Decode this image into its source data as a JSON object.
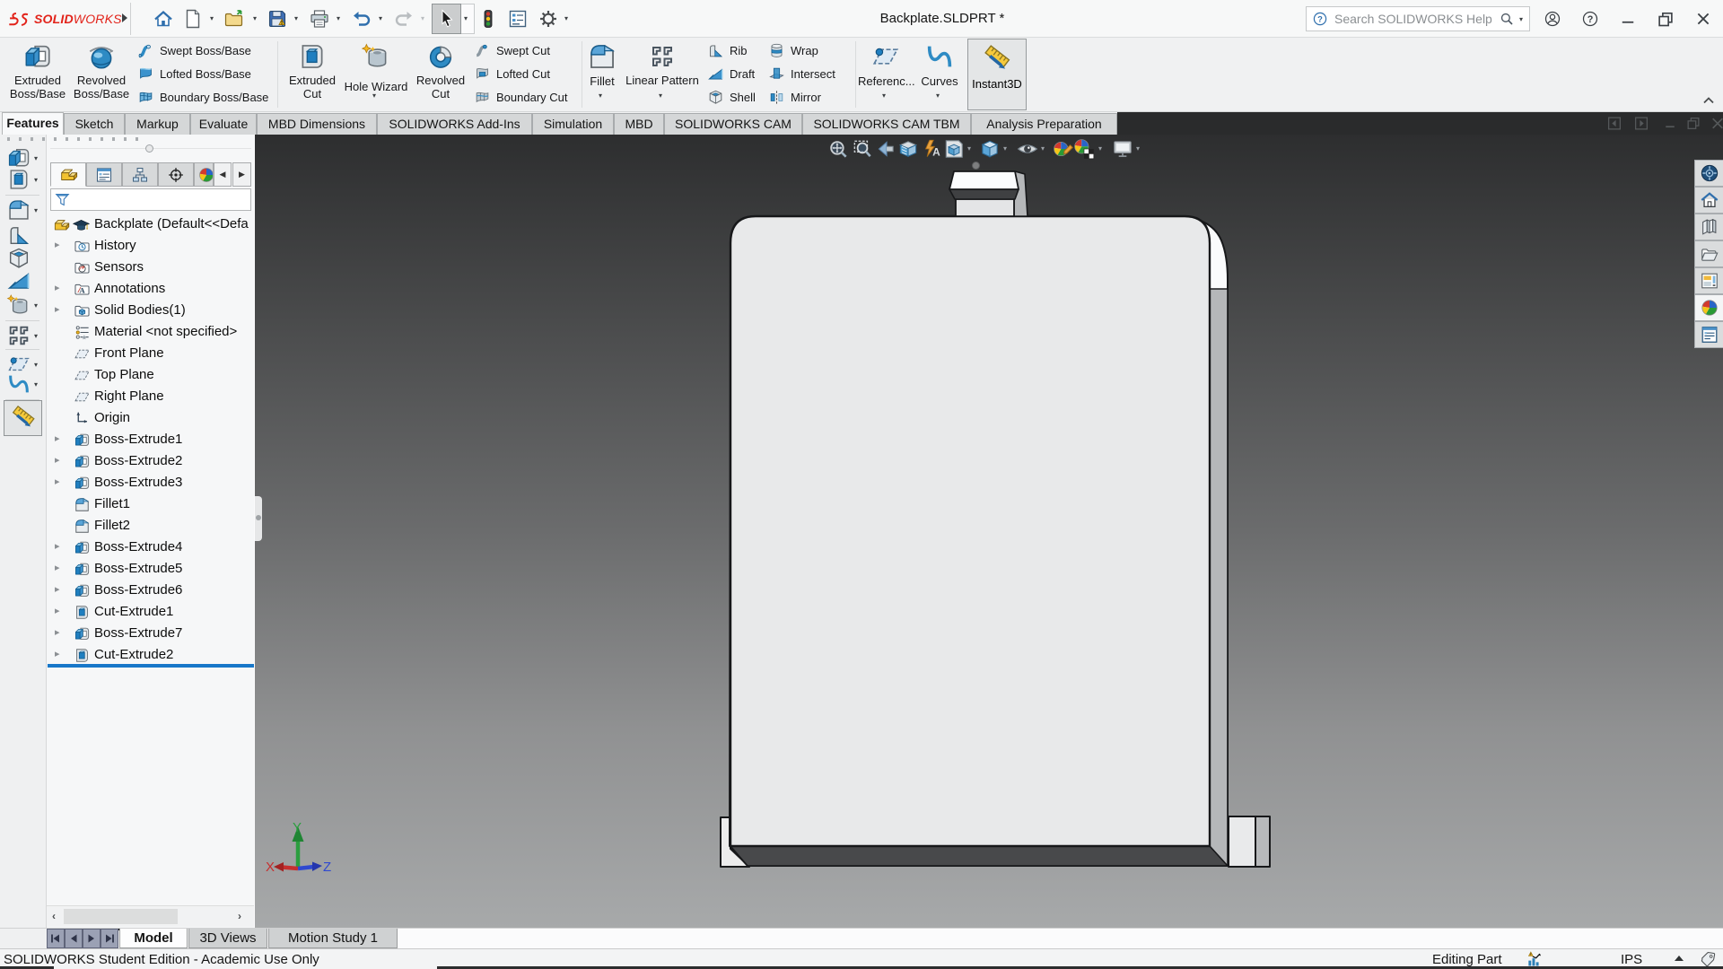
{
  "titlebar": {
    "brand_mark": "3S",
    "brand_bold": "SOLID",
    "brand_light": "WORKS",
    "document_title": "Backplate.SLDPRT *",
    "search_placeholder": "Search SOLIDWORKS Help",
    "quick_access_icons": [
      "home",
      "new-document",
      "open",
      "save",
      "print",
      "undo",
      "redo",
      "select-cursor",
      "rebuild",
      "file-properties",
      "options-gear"
    ],
    "window_icons": [
      "user-account",
      "help",
      "minimize",
      "restore",
      "close"
    ]
  },
  "ribbon": {
    "large_buttons": [
      {
        "line1": "Extruded",
        "line2": "Boss/Base",
        "icon": "extruded-boss-base"
      },
      {
        "line1": "Revolved",
        "line2": "Boss/Base",
        "icon": "revolved-boss-base"
      },
      {
        "line1": "Extruded",
        "line2": "Cut",
        "icon": "extruded-cut"
      },
      {
        "line1": "Hole Wizard",
        "line2": "",
        "icon": "hole-wizard"
      },
      {
        "line1": "Revolved",
        "line2": "Cut",
        "icon": "revolved-cut"
      },
      {
        "line1": "Fillet",
        "line2": "",
        "icon": "fillet"
      },
      {
        "line1": "Linear Pattern",
        "line2": "",
        "icon": "linear-pattern"
      },
      {
        "line1": "Referenc...",
        "line2": "",
        "icon": "reference-geometry"
      },
      {
        "line1": "Curves",
        "line2": "",
        "icon": "curves"
      },
      {
        "line1": "Instant3D",
        "line2": "",
        "icon": "instant3d",
        "active": true
      }
    ],
    "small_buttons": [
      {
        "label": "Swept Boss/Base",
        "icon": "swept-boss-base"
      },
      {
        "label": "Lofted Boss/Base",
        "icon": "lofted-boss-base"
      },
      {
        "label": "Boundary Boss/Base",
        "icon": "boundary-boss-base"
      },
      {
        "label": "Swept Cut",
        "icon": "swept-cut"
      },
      {
        "label": "Lofted Cut",
        "icon": "lofted-cut"
      },
      {
        "label": "Boundary Cut",
        "icon": "boundary-cut"
      },
      {
        "label": "Rib",
        "icon": "rib"
      },
      {
        "label": "Draft",
        "icon": "draft"
      },
      {
        "label": "Shell",
        "icon": "shell"
      },
      {
        "label": "Wrap",
        "icon": "wrap"
      },
      {
        "label": "Intersect",
        "icon": "intersect"
      },
      {
        "label": "Mirror",
        "icon": "mirror"
      }
    ],
    "collapse_icon": "chevron-up"
  },
  "command_tabs": [
    {
      "label": "Features",
      "active": true
    },
    {
      "label": "Sketch"
    },
    {
      "label": "Markup"
    },
    {
      "label": "Evaluate"
    },
    {
      "label": "MBD Dimensions"
    },
    {
      "label": "SOLIDWORKS Add-Ins"
    },
    {
      "label": "Simulation"
    },
    {
      "label": "MBD"
    },
    {
      "label": "SOLIDWORKS CAM"
    },
    {
      "label": "SOLIDWORKS CAM TBM"
    },
    {
      "label": "Analysis Preparation"
    }
  ],
  "document_window_icons": [
    "previous-window",
    "next-window",
    "minimize",
    "restore",
    "close"
  ],
  "left_toolbar_icons": [
    "extruded-boss-base",
    "extruded-cut",
    "fillet",
    "rib",
    "shell",
    "draft",
    "hole-wizard",
    "linear-pattern",
    "reference-geometry",
    "curves",
    "instant3d"
  ],
  "feature_manager": {
    "tab_icons": [
      "feature-tree",
      "property-manager",
      "configuration-manager",
      "dimxpert-manager",
      "display-manager"
    ],
    "scroll_icons": [
      "scroll-left",
      "scroll-right"
    ],
    "filter_icon": "filter-funnel",
    "tree": [
      {
        "label": "Backplate (Default<<Defa",
        "icon": "part",
        "icon2": "graduation-cap",
        "root": true
      },
      {
        "label": "History",
        "icon": "folder-history",
        "expandable": true
      },
      {
        "label": "Sensors",
        "icon": "folder-sensors"
      },
      {
        "label": "Annotations",
        "icon": "folder-annotations",
        "expandable": true
      },
      {
        "label": "Solid Bodies(1)",
        "icon": "folder-solid-bodies",
        "expandable": true
      },
      {
        "label": "Material <not specified>",
        "icon": "material"
      },
      {
        "label": "Front Plane",
        "icon": "plane"
      },
      {
        "label": "Top Plane",
        "icon": "plane"
      },
      {
        "label": "Right Plane",
        "icon": "plane"
      },
      {
        "label": "Origin",
        "icon": "origin"
      },
      {
        "label": "Boss-Extrude1",
        "icon": "boss-extrude",
        "expandable": true
      },
      {
        "label": "Boss-Extrude2",
        "icon": "boss-extrude",
        "expandable": true
      },
      {
        "label": "Boss-Extrude3",
        "icon": "boss-extrude",
        "expandable": true
      },
      {
        "label": "Fillet1",
        "icon": "fillet"
      },
      {
        "label": "Fillet2",
        "icon": "fillet"
      },
      {
        "label": "Boss-Extrude4",
        "icon": "boss-extrude",
        "expandable": true
      },
      {
        "label": "Boss-Extrude5",
        "icon": "boss-extrude",
        "expandable": true
      },
      {
        "label": "Boss-Extrude6",
        "icon": "boss-extrude",
        "expandable": true
      },
      {
        "label": "Cut-Extrude1",
        "icon": "cut-extrude",
        "expandable": true
      },
      {
        "label": "Boss-Extrude7",
        "icon": "boss-extrude",
        "expandable": true
      },
      {
        "label": "Cut-Extrude2",
        "icon": "cut-extrude",
        "expandable": true
      }
    ]
  },
  "viewport": {
    "heads_up_icons": [
      "zoom-to-fit",
      "zoom-to-area",
      "previous-view",
      "section-view",
      "dynamic-annotation-views",
      "view-orientation",
      "display-style",
      "hide-show-items",
      "edit-appearance",
      "apply-scene",
      "view-settings"
    ],
    "triad": {
      "x_label": "X",
      "y_label": "Y",
      "z_label": "Z",
      "x_color": "#cc2c2c",
      "y_color": "#2b9e3f",
      "z_color": "#2f49d0"
    }
  },
  "task_pane_icons": [
    "solidworks-resources",
    "home",
    "design-library",
    "file-explorer",
    "view-palette",
    "appearances-scenes",
    "custom-properties"
  ],
  "bottom_tabs": {
    "nav_icons": [
      "first",
      "previous",
      "next",
      "last"
    ],
    "tabs": [
      {
        "label": "Model",
        "active": true
      },
      {
        "label": "3D Views"
      },
      {
        "label": "Motion Study 1"
      }
    ]
  },
  "status_bar": {
    "left_text": "SOLIDWORKS Student Edition - Academic Use Only",
    "mode_text": "Editing Part",
    "units": "IPS",
    "icons": [
      "performance",
      "units-caret",
      "tag"
    ]
  },
  "colors": {
    "brand_red": "#e2231a",
    "rollback_bar": "#1777c9",
    "viewport_gradient_top": "#2d2e2f",
    "viewport_gradient_bottom": "#a7a9aa",
    "model_front_face": "#e8e9ea",
    "model_side_face": "#b5b7b9",
    "model_bottom_face": "#48494b"
  }
}
